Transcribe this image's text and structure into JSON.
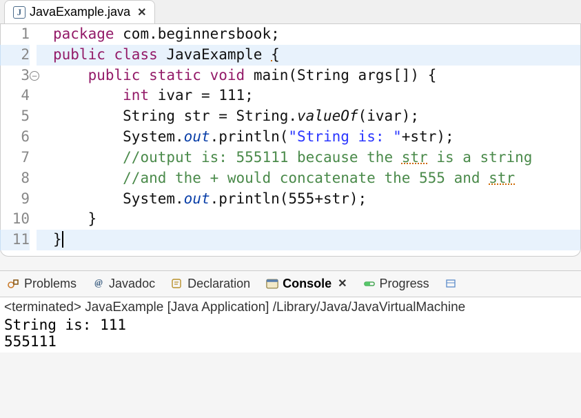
{
  "editor": {
    "tab": {
      "filename": "JavaExample.java"
    },
    "fold_line": 3,
    "highlight_lines": [
      2,
      11
    ],
    "lines": [
      {
        "n": 1,
        "tokens": [
          {
            "cls": "k",
            "t": "package"
          },
          {
            "cls": "t",
            "t": " com.beginnersbook;"
          }
        ]
      },
      {
        "n": 2,
        "tokens": [
          {
            "cls": "k",
            "t": "public"
          },
          {
            "cls": "t",
            "t": " "
          },
          {
            "cls": "k",
            "t": "class"
          },
          {
            "cls": "t",
            "t": " JavaExample "
          },
          {
            "cls": "squig",
            "t": "{"
          }
        ]
      },
      {
        "n": 3,
        "indent": 1,
        "tokens": [
          {
            "cls": "k",
            "t": "public"
          },
          {
            "cls": "t",
            "t": " "
          },
          {
            "cls": "k",
            "t": "static"
          },
          {
            "cls": "t",
            "t": " "
          },
          {
            "cls": "k",
            "t": "void"
          },
          {
            "cls": "t",
            "t": " main(String args[]) {"
          }
        ]
      },
      {
        "n": 4,
        "indent": 2,
        "tokens": [
          {
            "cls": "k",
            "t": "int"
          },
          {
            "cls": "t",
            "t": " ivar = 111;"
          }
        ]
      },
      {
        "n": 5,
        "indent": 2,
        "tokens": [
          {
            "cls": "t",
            "t": "String str = String."
          },
          {
            "cls": "mi",
            "t": "valueOf"
          },
          {
            "cls": "t",
            "t": "(ivar);"
          }
        ]
      },
      {
        "n": 6,
        "indent": 2,
        "tokens": [
          {
            "cls": "t",
            "t": "System."
          },
          {
            "cls": "fi",
            "t": "out"
          },
          {
            "cls": "t",
            "t": ".println("
          },
          {
            "cls": "s",
            "t": "\"String is: \""
          },
          {
            "cls": "t",
            "t": "+str);"
          }
        ]
      },
      {
        "n": 7,
        "indent": 2,
        "tokens": [
          {
            "cls": "c",
            "t": "//output is: 555111 because the "
          },
          {
            "cls": "c squig",
            "t": "str"
          },
          {
            "cls": "c",
            "t": " is a string"
          }
        ]
      },
      {
        "n": 8,
        "indent": 2,
        "tokens": [
          {
            "cls": "c",
            "t": "//and the + would concatenate the 555 and "
          },
          {
            "cls": "c squig",
            "t": "str"
          }
        ]
      },
      {
        "n": 9,
        "indent": 2,
        "tokens": [
          {
            "cls": "t",
            "t": "System."
          },
          {
            "cls": "fi",
            "t": "out"
          },
          {
            "cls": "t",
            "t": ".println(555+str);"
          }
        ]
      },
      {
        "n": 10,
        "indent": 1,
        "tokens": [
          {
            "cls": "t",
            "t": "}"
          }
        ]
      },
      {
        "n": 11,
        "tokens": [
          {
            "cls": "t",
            "t": "}"
          },
          {
            "cls": "cursor",
            "t": ""
          }
        ]
      }
    ]
  },
  "bottom_tabs": {
    "items": [
      {
        "name": "problems",
        "label": "Problems"
      },
      {
        "name": "javadoc",
        "label": "Javadoc"
      },
      {
        "name": "declaration",
        "label": "Declaration"
      },
      {
        "name": "console",
        "label": "Console",
        "active": true,
        "closable": true
      },
      {
        "name": "progress",
        "label": "Progress"
      }
    ]
  },
  "console": {
    "status": "<terminated> JavaExample [Java Application] /Library/Java/JavaVirtualMachine",
    "output": "String is: 111\n555111"
  }
}
